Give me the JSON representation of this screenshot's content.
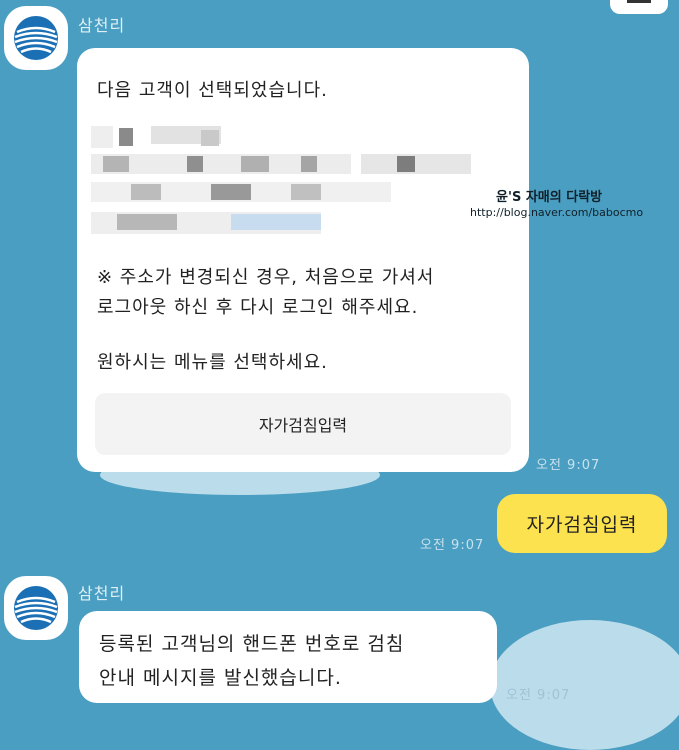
{
  "chat": {
    "sender_name": "삼천리",
    "message1": {
      "line1": "다음 고객이 선택되었습니다.",
      "notice_line1": "※ 주소가 변경되신 경우, 처음으로 가셔서",
      "notice_line2": "로그아웃 하신 후 다시 로그인 해주세요.",
      "prompt": "원하시는 메뉴를 선택하세요.",
      "button_label": "자가검침입력",
      "time": "오전 9:07"
    },
    "my_message": {
      "text": "자가검침입력",
      "time": "오전 9:07"
    },
    "message2": {
      "line1": "등록된 고객님의 핸드폰 번호로 검침",
      "line2": "안내 메시지를 발신했습니다.",
      "time": "오전 9:07"
    }
  },
  "watermark": {
    "title": "윤'S 자매의 다락방",
    "url": "http://blog.naver.com/babocmo"
  },
  "colors": {
    "background": "#4a9ec1",
    "my_bubble": "#fde24f",
    "bubble": "#ffffff",
    "brand_blue": "#1b6fb5"
  },
  "icons": {
    "avatar": "samchully-logo-icon",
    "menu": "menu-icon"
  }
}
